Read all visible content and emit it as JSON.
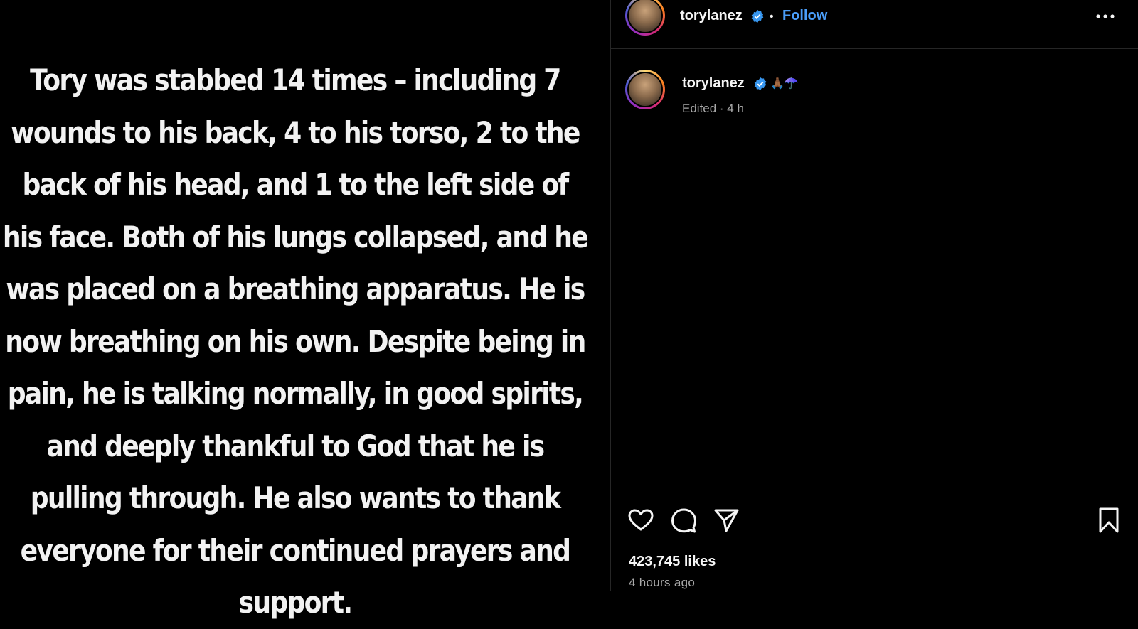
{
  "media": {
    "caption_text": "Tory was stabbed 14 times – including 7 wounds to his back, 4 to his torso, 2 to the back of his head, and 1 to the left side of his face. Both of his lungs collapsed, and he was placed on a breathing apparatus. He is now breathing on his own. Despite being in pain, he is talking normally, in good spirits, and deeply thankful to God that he is pulling through. He also wants to thank everyone for their continued prayers and support."
  },
  "header": {
    "username": "torylanez",
    "separator": "•",
    "follow_label": "Follow",
    "more_icon": "more-horizontal-icon"
  },
  "caption": {
    "username": "torylanez",
    "emojis": "🙏🏾☂️",
    "meta": "Edited · 4 h"
  },
  "footer": {
    "likes": "423,745 likes",
    "time_ago": "4 hours ago"
  },
  "colors": {
    "background": "#000000",
    "accent": "#4a9df8",
    "muted": "#a8a8a8",
    "divider": "#262626"
  }
}
